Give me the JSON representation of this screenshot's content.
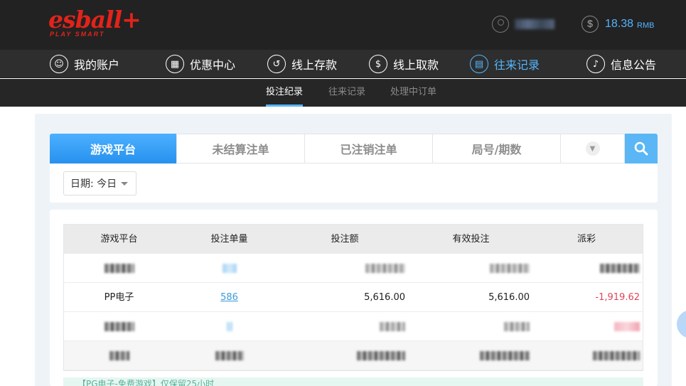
{
  "logo": {
    "main": "esball+",
    "sub": "PLAY SMART"
  },
  "header": {
    "balance_value": "18.38",
    "balance_currency": "RMB"
  },
  "main_nav": [
    {
      "label": "我的账户",
      "icon": "user-icon"
    },
    {
      "label": "优惠中心",
      "icon": "gift-icon"
    },
    {
      "label": "线上存款",
      "icon": "deposit-icon"
    },
    {
      "label": "线上取款",
      "icon": "withdraw-icon"
    },
    {
      "label": "往来记录",
      "icon": "records-icon",
      "active": true
    },
    {
      "label": "信息公告",
      "icon": "bell-icon"
    }
  ],
  "sub_nav": [
    {
      "label": "投注纪录",
      "active": true
    },
    {
      "label": "往来记录"
    },
    {
      "label": "处理中订单"
    }
  ],
  "tabs": [
    {
      "label": "游戏平台",
      "active": true
    },
    {
      "label": "未结算注单"
    },
    {
      "label": "已注销注单"
    },
    {
      "label": "局号/期数"
    }
  ],
  "date_filter": {
    "label": "日期: 今日"
  },
  "table": {
    "columns": [
      "游戏平台",
      "投注单量",
      "投注额",
      "有效投注",
      "派彩"
    ],
    "visible_row": {
      "platform": "PP电子",
      "bet_count": "586",
      "bet_amount": "5,616.00",
      "valid_bet": "5,616.00",
      "payout": "-1,919.62"
    }
  },
  "notice": {
    "text": "【PG电子-免费游戏】仅保留25小时"
  },
  "colors": {
    "accent": "#54b5ff",
    "brand": "#e2231a",
    "negative": "#e0445a"
  }
}
